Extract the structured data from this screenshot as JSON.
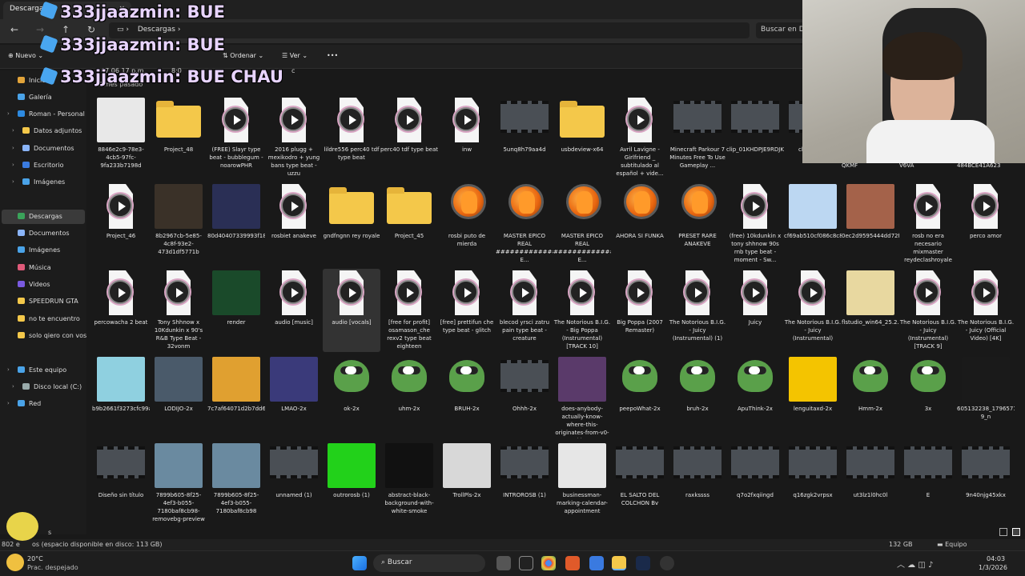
{
  "window": {
    "tab_title": "Descargas",
    "tab_close": "×"
  },
  "address": {
    "breadcrumb": "Descargas",
    "search_placeholder": "Buscar en De"
  },
  "toolbar": {
    "new_label": "Nuevo",
    "sort_label": "Ordenar",
    "view_label": "Ver",
    "more_label": "•••"
  },
  "sidebar": {
    "items": [
      {
        "label": "Inicio",
        "color": "#e2a43a"
      },
      {
        "label": "Galería",
        "color": "#4aa3e8"
      },
      {
        "label": "Roman - Personal",
        "color": "#2d8ae0"
      },
      {
        "label": "Datos adjuntos",
        "color": "#f4c84a"
      },
      {
        "label": "Documentos",
        "color": "#8ab4f8"
      },
      {
        "label": "Escritorio",
        "color": "#3a7be0"
      },
      {
        "label": "Imágenes",
        "color": "#4aa3e8"
      },
      {
        "label": "Descargas",
        "color": "#3aa35a"
      },
      {
        "label": "Documentos",
        "color": "#8ab4f8"
      },
      {
        "label": "Imágenes",
        "color": "#4aa3e8"
      },
      {
        "label": "Música",
        "color": "#e05a7a"
      },
      {
        "label": "Videos",
        "color": "#7a5ae0"
      },
      {
        "label": "SPEEDRUN GTA",
        "color": "#f4c84a"
      },
      {
        "label": "no te encuentro",
        "color": "#f4c84a"
      },
      {
        "label": "solo qiero con vos",
        "color": "#f4c84a"
      },
      {
        "label": "Este equipo",
        "color": "#4aa3e8"
      },
      {
        "label": "Disco local (C:)",
        "color": "#9aa"
      },
      {
        "label": "Red",
        "color": "#4aa3e8"
      }
    ]
  },
  "group_header": "El mes pasado",
  "partial_row": [
    "07 06 17 p.m.",
    "8:0",
    "c"
  ],
  "files": [
    {
      "name": "8846e2c9-78e3-4cb5-97fc-9fa233b7198d",
      "kind": "img",
      "color": "#e8e8e8"
    },
    {
      "name": "Project_48",
      "kind": "zip"
    },
    {
      "name": "(FREE) Slayr type beat - bubblegum - noarowPHR",
      "kind": "audio"
    },
    {
      "name": "2016 plugg + mexikodro + yung bans type beat - uzzu",
      "kind": "audio"
    },
    {
      "name": "lildre556 perc40 tdf type beat",
      "kind": "audio"
    },
    {
      "name": "perc40 tdf type beat",
      "kind": "audio"
    },
    {
      "name": "inw",
      "kind": "audio"
    },
    {
      "name": "5unq8h79aa4d",
      "kind": "video"
    },
    {
      "name": "usbdeview-x64",
      "kind": "zip"
    },
    {
      "name": "Avril Lavigne - Girlfriend _ subtitulado al español + vide...",
      "kind": "audio"
    },
    {
      "name": "Minecraft Parkour 7 Minutes Free To Use Gameplay ...",
      "kind": "video"
    },
    {
      "name": "clip_01KHDPJE9RDJKQ1A5SM01R2CP",
      "kind": "video"
    },
    {
      "name": "clip_ 4RP1",
      "kind": "video"
    },
    {
      "name": "QKMF",
      "kind": "hidden"
    },
    {
      "name": "V6VA",
      "kind": "hidden"
    },
    {
      "name": "484BCE41A623",
      "kind": "hidden"
    },
    {
      "name": "Project_46",
      "kind": "audio"
    },
    {
      "name": "8b2967cb-5e85-4c8f-93e2-473d1df5771b",
      "kind": "img",
      "color": "#3a3128"
    },
    {
      "name": "80d40407339993f18e2ab08aac256317",
      "kind": "img",
      "color": "#2a2f55"
    },
    {
      "name": "rosbiet anakeve",
      "kind": "audio"
    },
    {
      "name": "gndfngnn rey royale",
      "kind": "folder"
    },
    {
      "name": "Project_45",
      "kind": "folder"
    },
    {
      "name": "rosbi puto de mierda",
      "kind": "fl"
    },
    {
      "name": "MASTER EPICO REAL ################MASTER E...",
      "kind": "fl"
    },
    {
      "name": "MASTER EPICO REAL ################MASTER E...",
      "kind": "fl"
    },
    {
      "name": "AHORA SI FUNKA",
      "kind": "fl"
    },
    {
      "name": "PRESET RARE ANAKEVE",
      "kind": "fl"
    },
    {
      "name": "(free) 10kdunkin x tony shhnow 90s rnb type beat - moment - Sw...",
      "kind": "audio"
    },
    {
      "name": "cf69ab510cf086c8c885b73b54970482",
      "kind": "img",
      "color": "#bcd7f2"
    },
    {
      "name": "0ec2d9595444dd72f4dfb5baeab5fa8e",
      "kind": "img",
      "color": "#a4624a"
    },
    {
      "name": "rosb no era necesario mixmaster reydeclashroyale",
      "kind": "audio"
    },
    {
      "name": "perco amor",
      "kind": "audio"
    },
    {
      "name": "percowacha 2 beat",
      "kind": "audio"
    },
    {
      "name": "Tony Shhnow x 10Kdunkin x 90's R&B Type Beat - 32vonm",
      "kind": "audio"
    },
    {
      "name": "render",
      "kind": "img",
      "color": "#1a4a2a"
    },
    {
      "name": "audio [music]",
      "kind": "audio"
    },
    {
      "name": "audio [vocals]",
      "kind": "audio",
      "selected": true
    },
    {
      "name": "[free for profit] osamason_che rexv2 type beat eighteen",
      "kind": "audio"
    },
    {
      "name": "[free] prettifun che type beat - glitch",
      "kind": "audio"
    },
    {
      "name": "blecod yrsci zatru pain type beat - creature",
      "kind": "audio"
    },
    {
      "name": "The Notorious B.I.G. - Big Poppa (Instrumental) [TRACK 10]",
      "kind": "audio"
    },
    {
      "name": "Big Poppa (2007 Remaster)",
      "kind": "audio"
    },
    {
      "name": "The Notorious B.I.G. - Juicy (Instrumental) (1)",
      "kind": "audio"
    },
    {
      "name": "Juicy",
      "kind": "audio"
    },
    {
      "name": "The Notorious B.I.G. - Juicy (Instrumental)",
      "kind": "audio"
    },
    {
      "name": "flstudio_win64_25.2.4.5242",
      "kind": "img",
      "color": "#e8d8a0"
    },
    {
      "name": "The Notorious B.I.G. - Juicy (Instrumental) [TRACK 9]",
      "kind": "audio"
    },
    {
      "name": "The Notorious B.I.G. - Juicy (Official Video) [4K]",
      "kind": "audio"
    },
    {
      "name": "b9b2661f3273cfc99adc4fe3f5cf422d",
      "kind": "img",
      "color": "#8fd0e0"
    },
    {
      "name": "LODIJO-2x",
      "kind": "img",
      "color": "#4a5a6a"
    },
    {
      "name": "7c7af64071d2b7dd6dd6d32e024bf0af",
      "kind": "img",
      "color": "#e0a030"
    },
    {
      "name": "LMAO-2x",
      "kind": "img",
      "color": "#3a3a7a"
    },
    {
      "name": "ok-2x",
      "kind": "pepe"
    },
    {
      "name": "uhm-2x",
      "kind": "pepe"
    },
    {
      "name": "BRUH-2x",
      "kind": "pepe"
    },
    {
      "name": "Ohhh-2x",
      "kind": "video"
    },
    {
      "name": "does-anybody-actually-know-where-this-originates-from-v0-nkiq...",
      "kind": "img",
      "color": "#5a3a6a"
    },
    {
      "name": "peepoWhat-2x",
      "kind": "pepe"
    },
    {
      "name": "bruh-2x",
      "kind": "pepe"
    },
    {
      "name": "ApuThink-2x",
      "kind": "pepe"
    },
    {
      "name": "lenguitaxd-2x",
      "kind": "img",
      "color": "#f4c400"
    },
    {
      "name": "Hmm-2x",
      "kind": "pepe"
    },
    {
      "name": "3x",
      "kind": "pepe"
    },
    {
      "name": "605132238_17965710162005972_80338631415577281 9_n",
      "kind": "img",
      "color": "#1a1a1a"
    },
    {
      "name": "Diseño sin título",
      "kind": "video"
    },
    {
      "name": "7899b605-8f25-4ef3-b055-7180baf8cb98-removebg-preview",
      "kind": "img",
      "color": "#6a8aa0"
    },
    {
      "name": "7899b605-8f25-4ef3-b055-7180baf8cb98",
      "kind": "img",
      "color": "#6a8aa0"
    },
    {
      "name": "unnamed (1)",
      "kind": "video"
    },
    {
      "name": "outrorosb (1)",
      "kind": "img",
      "color": "#22d11a"
    },
    {
      "name": "abstract-black-background-with-white-smoke",
      "kind": "img",
      "color": "#111111"
    },
    {
      "name": "TrollPls-2x",
      "kind": "img",
      "color": "#d8d8d8"
    },
    {
      "name": "INTROROSB (1)",
      "kind": "video"
    },
    {
      "name": "businessman-marking-calendar-appointment",
      "kind": "img",
      "color": "#e6e6e6"
    },
    {
      "name": "EL SALTO DEL COLCHON Bv",
      "kind": "video"
    },
    {
      "name": "raxkssss",
      "kind": "video"
    },
    {
      "name": "q7o2fxqiingd",
      "kind": "video"
    },
    {
      "name": "q16zgk2vrpsx",
      "kind": "video"
    },
    {
      "name": "ut3lz1l0hc0l",
      "kind": "video"
    },
    {
      "name": "E",
      "kind": "video"
    },
    {
      "name": "9n40njg45xkx",
      "kind": "video"
    }
  ],
  "status": {
    "items_count": "802 e",
    "disk_text": "os (espacio disponible en disco: 113 GB)",
    "bottom_left": "s",
    "size": "132 GB",
    "location": "Equipo"
  },
  "taskbar": {
    "weather_temp": "20°C",
    "weather_desc": "Prac. despejado",
    "search_label": "Buscar",
    "time": "04:03",
    "date": "1/3/2026"
  },
  "overlay": {
    "chat_lines": [
      "333jjaazmin: BUE",
      "333jjaazmin: BUE",
      "333jjaazmin: BUE CHAU"
    ]
  }
}
